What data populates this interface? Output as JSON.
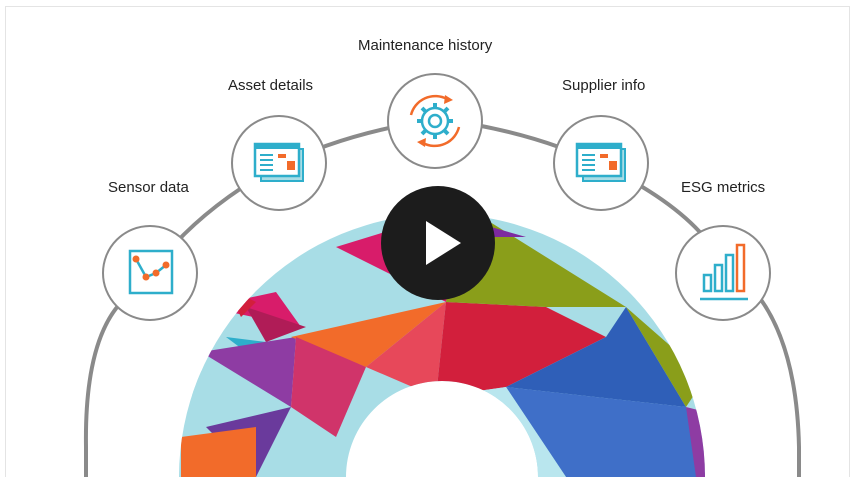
{
  "nodes": {
    "sensor": {
      "label": "Sensor data",
      "icon": "line-chart-icon"
    },
    "asset": {
      "label": "Asset details",
      "icon": "dashboard-window-icon"
    },
    "maintenance": {
      "label": "Maintenance history",
      "icon": "gear-cycle-icon"
    },
    "supplier": {
      "label": "Supplier info",
      "icon": "dashboard-window-icon"
    },
    "esg": {
      "label": "ESG metrics",
      "icon": "bar-chart-icon"
    }
  },
  "video": {
    "control": "play-icon"
  },
  "colors": {
    "ring": "#8a8a8a",
    "icon_teal": "#2eaecb",
    "icon_orange": "#f26b2a",
    "play_bg": "#1c1c1c"
  }
}
